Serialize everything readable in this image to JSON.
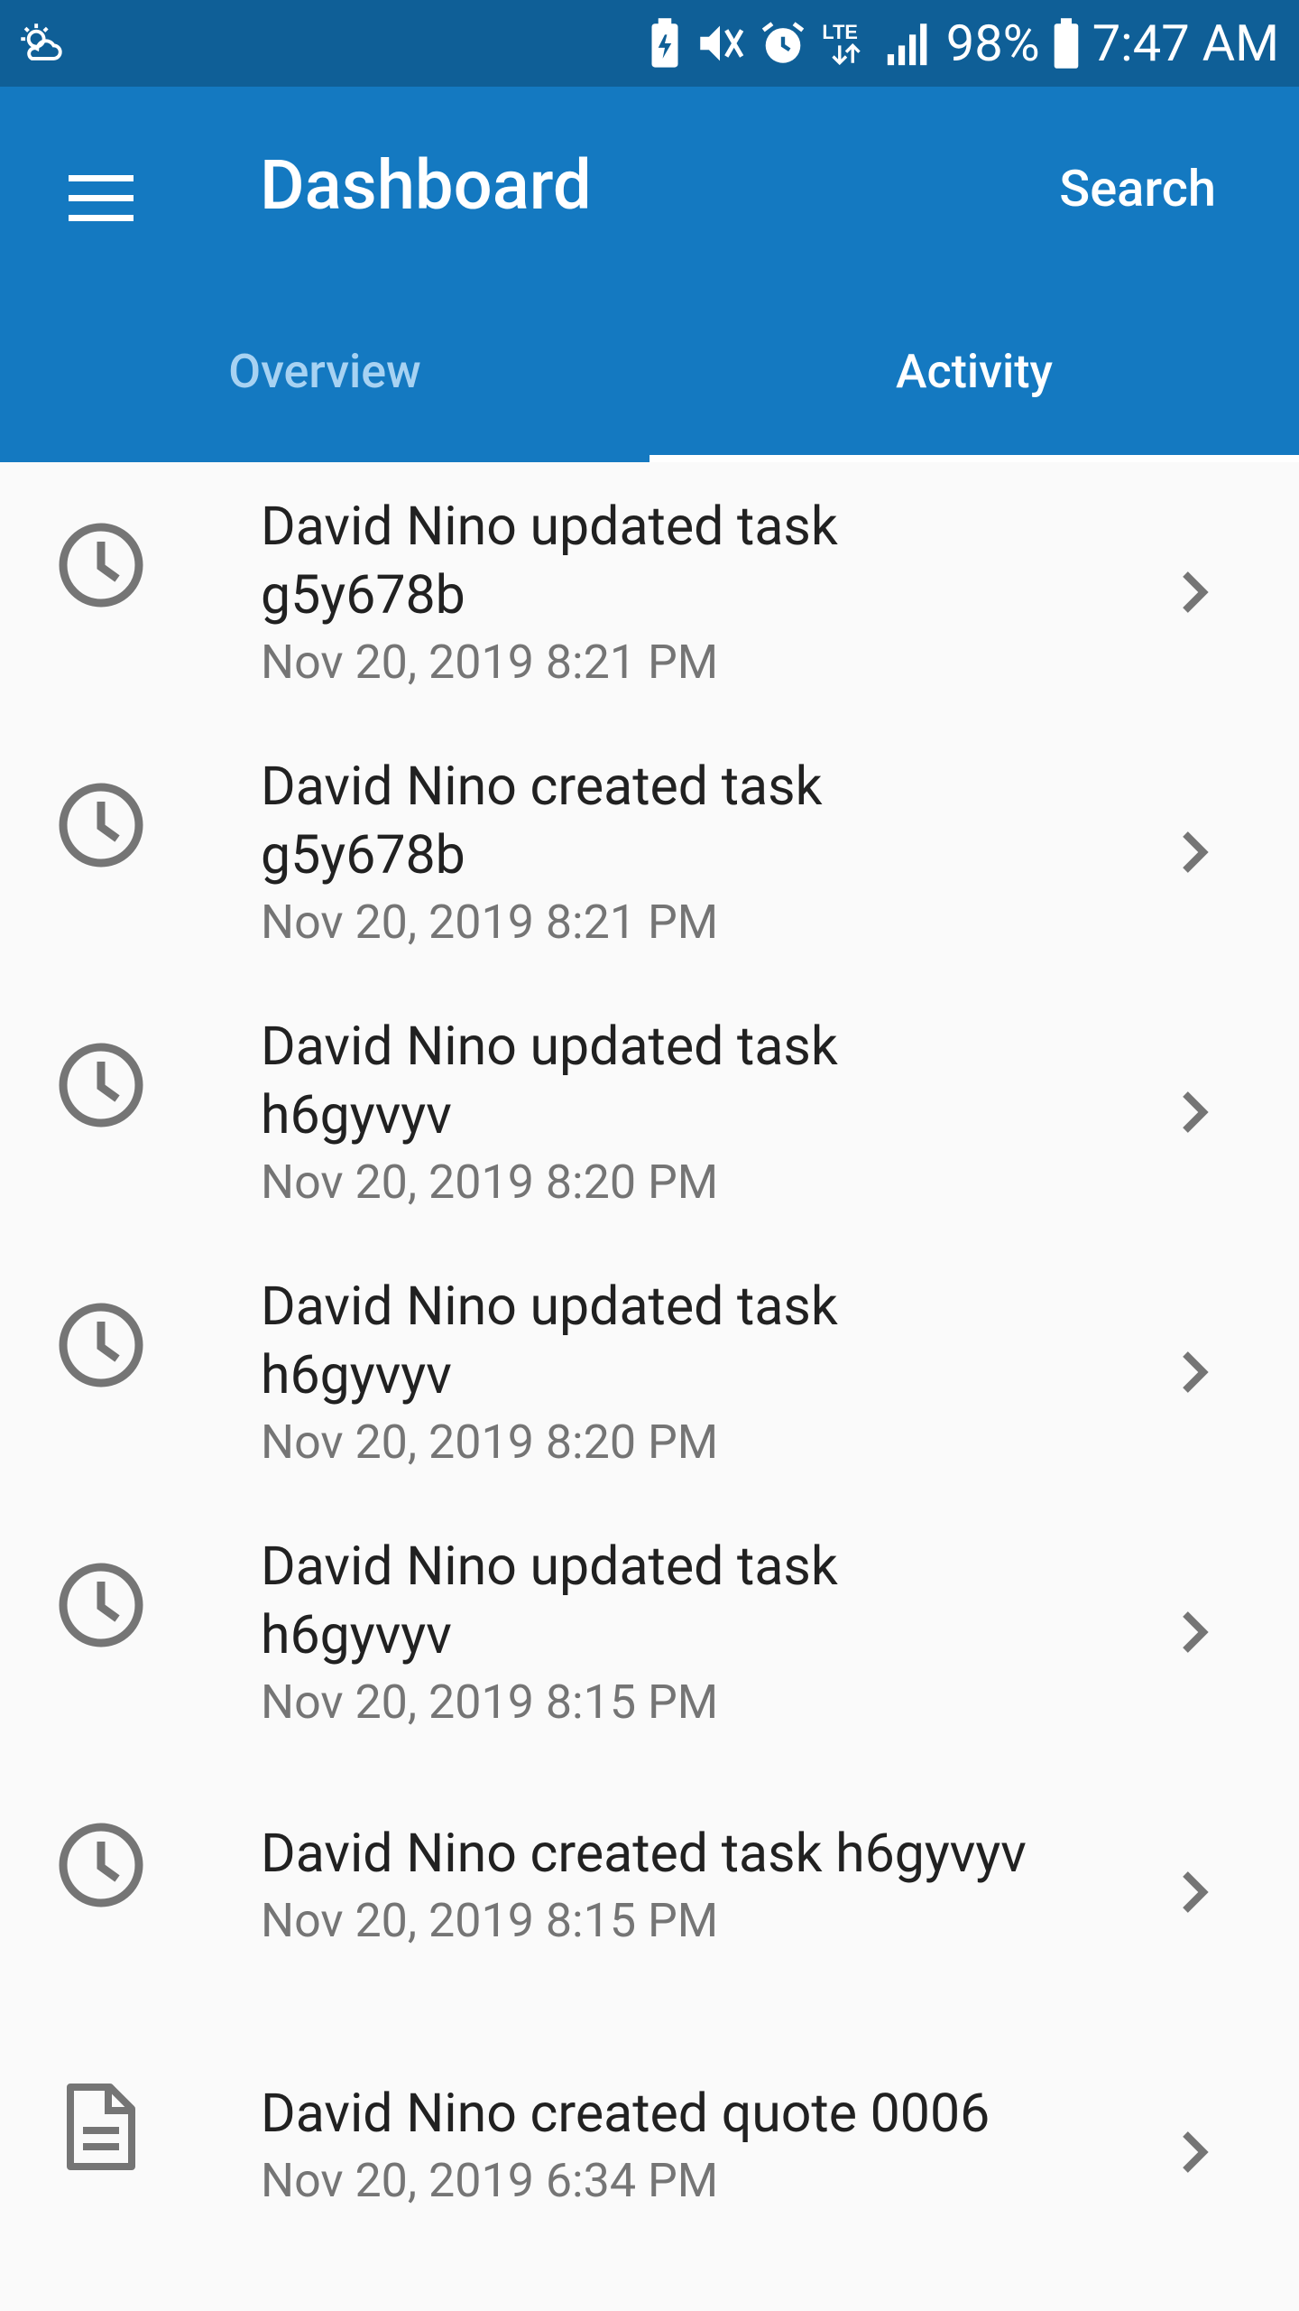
{
  "status_bar": {
    "battery_percent": "98%",
    "time": "7:47 AM",
    "network": "LTE",
    "icons": [
      "weather-icon",
      "battery-saver-icon",
      "mute-icon",
      "alarm-icon",
      "lte-icon",
      "signal-icon",
      "battery-icon"
    ]
  },
  "app_bar": {
    "title": "Dashboard",
    "search_label": "Search",
    "menu_icon": "hamburger-menu-icon",
    "color": "#1479c1"
  },
  "tabs": [
    {
      "label": "Overview",
      "active": false
    },
    {
      "label": "Activity",
      "active": true
    }
  ],
  "activity": [
    {
      "title_line1": "David Nino updated task",
      "title_line2": "g5y678b",
      "date": "Nov 20, 2019 8:21 PM",
      "icon": "clock-icon"
    },
    {
      "title_line1": "David Nino created task",
      "title_line2": "g5y678b",
      "date": "Nov 20, 2019 8:21 PM",
      "icon": "clock-icon"
    },
    {
      "title_line1": "David Nino updated task",
      "title_line2": "h6gyvyv",
      "date": "Nov 20, 2019 8:20 PM",
      "icon": "clock-icon"
    },
    {
      "title_line1": "David Nino updated task",
      "title_line2": "h6gyvyv",
      "date": "Nov 20, 2019 8:20 PM",
      "icon": "clock-icon"
    },
    {
      "title_line1": "David Nino updated task",
      "title_line2": "h6gyvyv",
      "date": "Nov 20, 2019 8:15 PM",
      "icon": "clock-icon"
    },
    {
      "title_line1": "David Nino created task h6gyvyv",
      "title_line2": "",
      "date": "Nov 20, 2019 8:15 PM",
      "icon": "clock-icon"
    },
    {
      "title_line1": "David Nino created quote 0006",
      "title_line2": "",
      "date": "Nov 20, 2019 6:34 PM",
      "icon": "document-icon"
    }
  ]
}
